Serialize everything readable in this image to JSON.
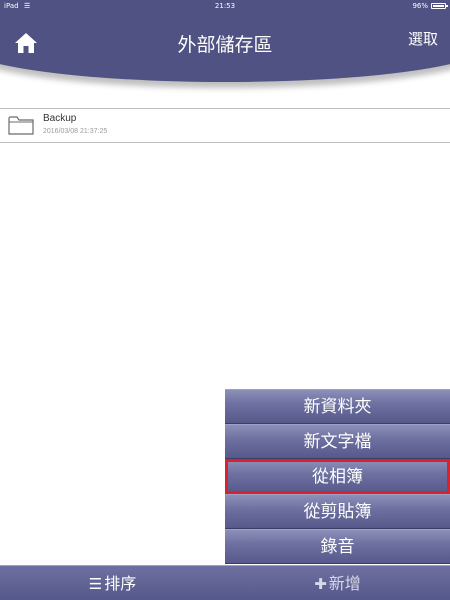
{
  "status_bar": {
    "carrier": "iPad",
    "time": "21:53",
    "battery": "96%"
  },
  "header": {
    "title": "外部儲存區",
    "select_label": "選取"
  },
  "files": [
    {
      "name": "Backup",
      "date": "2016/03/08 21:37:25",
      "icon": "folder-icon"
    }
  ],
  "add_menu": {
    "items": [
      {
        "label": "新資料夾"
      },
      {
        "label": "新文字檔"
      },
      {
        "label": "從相簿",
        "highlighted": true
      },
      {
        "label": "從剪貼簿"
      },
      {
        "label": "錄音"
      }
    ]
  },
  "toolbar": {
    "sort_label": "排序",
    "add_label": "新增"
  },
  "colors": {
    "accent": "#4f5282",
    "highlight": "#d9222b"
  }
}
